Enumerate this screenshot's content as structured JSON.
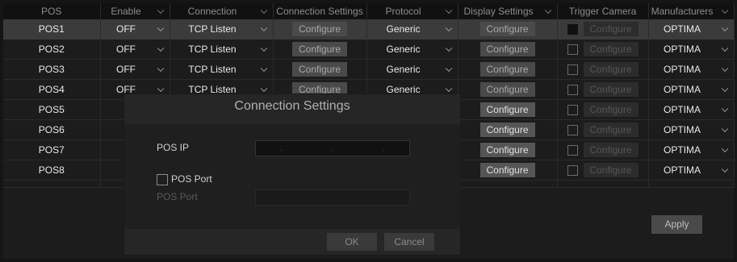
{
  "columns": {
    "pos": "POS",
    "enable": "Enable",
    "connection": "Connection",
    "connection_settings": "Connection Settings",
    "protocol": "Protocol",
    "display_settings": "Display Settings",
    "trigger_camera": "Trigger Camera",
    "manufacturers": "Manufacturers"
  },
  "rows": [
    {
      "pos": "POS1",
      "enable": "OFF",
      "connection": "TCP Listen",
      "conn_cfg": "Configure",
      "protocol": "Generic",
      "disp_cfg": "Configure",
      "trig_cfg": "Configure",
      "manufacturer": "OPTIMA"
    },
    {
      "pos": "POS2",
      "enable": "OFF",
      "connection": "TCP Listen",
      "conn_cfg": "Configure",
      "protocol": "Generic",
      "disp_cfg": "Configure",
      "trig_cfg": "Configure",
      "manufacturer": "OPTIMA"
    },
    {
      "pos": "POS3",
      "enable": "OFF",
      "connection": "TCP Listen",
      "conn_cfg": "Configure",
      "protocol": "Generic",
      "disp_cfg": "Configure",
      "trig_cfg": "Configure",
      "manufacturer": "OPTIMA"
    },
    {
      "pos": "POS4",
      "enable": "OFF",
      "connection": "TCP Listen",
      "conn_cfg": "Configure",
      "protocol": "Generic",
      "disp_cfg": "Configure",
      "trig_cfg": "Configure",
      "manufacturer": "OPTIMA"
    },
    {
      "pos": "POS5",
      "enable": "",
      "connection": "",
      "conn_cfg": "",
      "protocol": "",
      "disp_cfg": "Configure",
      "trig_cfg": "Configure",
      "manufacturer": "OPTIMA"
    },
    {
      "pos": "POS6",
      "enable": "",
      "connection": "",
      "conn_cfg": "",
      "protocol": "",
      "disp_cfg": "Configure",
      "trig_cfg": "Configure",
      "manufacturer": "OPTIMA"
    },
    {
      "pos": "POS7",
      "enable": "",
      "connection": "",
      "conn_cfg": "",
      "protocol": "",
      "disp_cfg": "Configure",
      "trig_cfg": "Configure",
      "manufacturer": "OPTIMA"
    },
    {
      "pos": "POS8",
      "enable": "",
      "connection": "",
      "conn_cfg": "",
      "protocol": "",
      "disp_cfg": "Configure",
      "trig_cfg": "Configure",
      "manufacturer": "OPTIMA"
    }
  ],
  "apply_label": "Apply",
  "dialog": {
    "title": "Connection Settings",
    "pos_ip_label": "POS IP",
    "ip_dots": [
      ".",
      ".",
      "."
    ],
    "pos_port_checkbox_label": "POS Port",
    "pos_port_field_label": "POS Port",
    "ok_label": "OK",
    "cancel_label": "Cancel"
  }
}
